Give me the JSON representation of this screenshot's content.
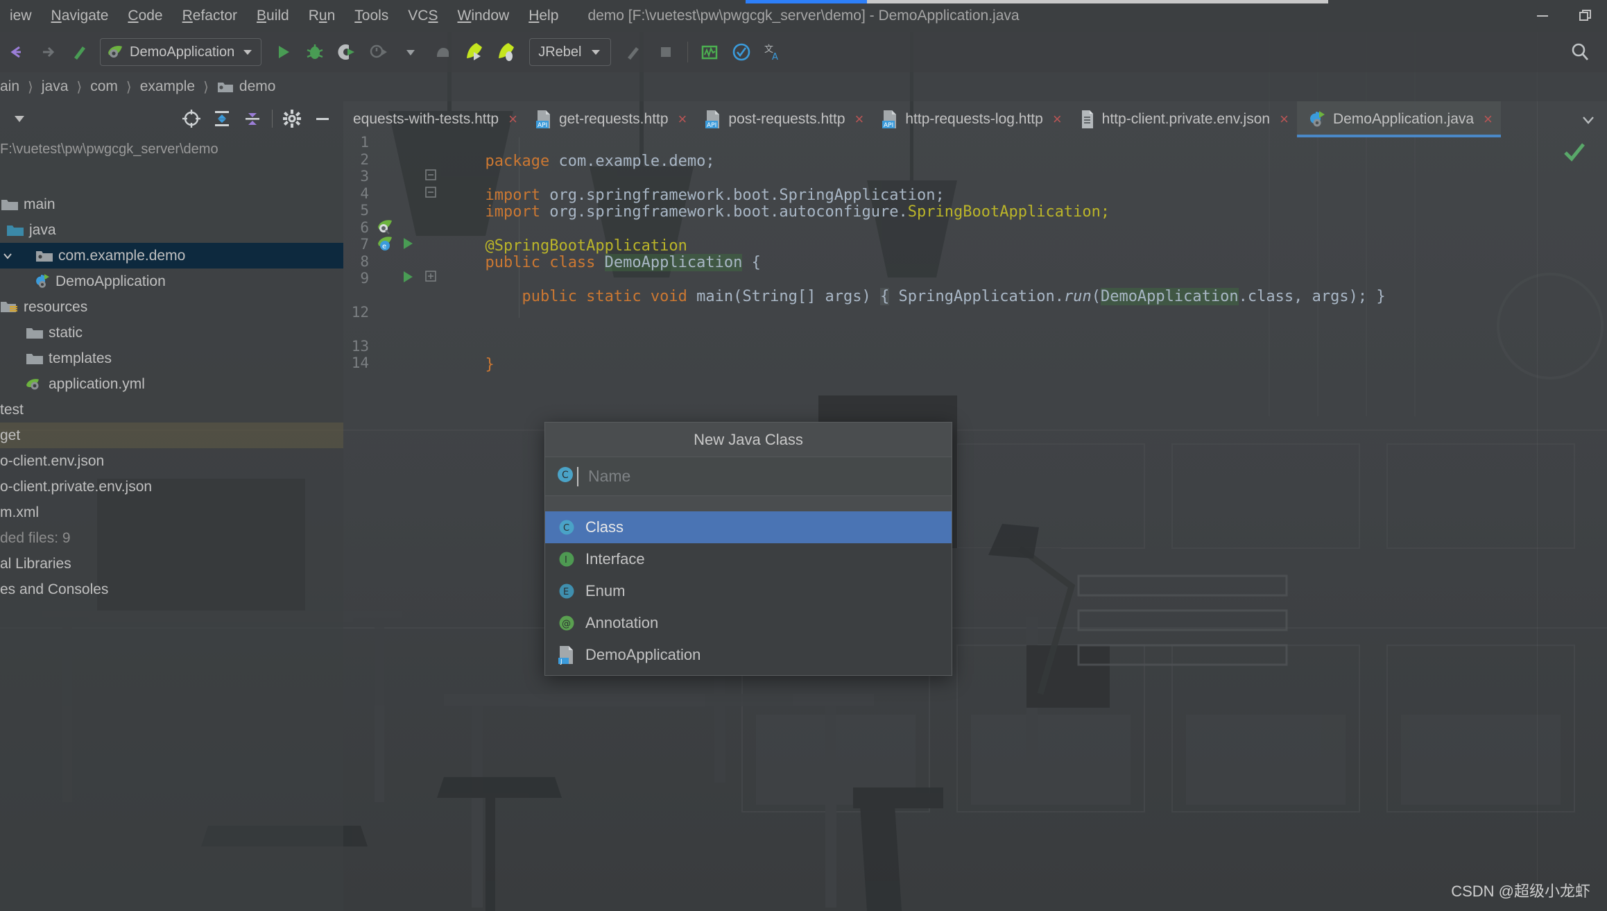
{
  "window": {
    "title": "demo [F:\\vuetest\\pw\\pwgcgk_server\\demo] - DemoApplication.java",
    "minimize_label": "minimize-window",
    "restore_label": "restore-window"
  },
  "menubar": {
    "items": [
      {
        "label": "iew",
        "mnemonic": ""
      },
      {
        "label": "Navigate",
        "mnemonic": "N"
      },
      {
        "label": "Code",
        "mnemonic": "C"
      },
      {
        "label": "Refactor",
        "mnemonic": "R"
      },
      {
        "label": "Build",
        "mnemonic": "B"
      },
      {
        "label": "Run",
        "mnemonic": "u"
      },
      {
        "label": "Tools",
        "mnemonic": "T"
      },
      {
        "label": "VCS",
        "mnemonic": "S"
      },
      {
        "label": "Window",
        "mnemonic": "W"
      },
      {
        "label": "Help",
        "mnemonic": "H"
      }
    ]
  },
  "toolbar": {
    "run_configuration": "DemoApplication",
    "jrebel_label": "JRebel",
    "icons": [
      "back-arrow-icon",
      "forward-arrow-icon",
      "build-hammer-icon",
      "run-icon",
      "debug-icon",
      "run-with-coverage-icon",
      "profiler-icon",
      "dropdown-icon",
      "attach-icon",
      "jrebel-run-icon",
      "jrebel-debug-icon",
      "build-project-icon",
      "stop-icon",
      "monitor-icon",
      "checked-circle-icon",
      "translate-icon",
      "search-everywhere-icon"
    ]
  },
  "breadcrumb": {
    "items": [
      "ain",
      "java",
      "com",
      "example",
      "demo"
    ]
  },
  "project_panel": {
    "toolbar_icons": [
      "select-opened-file-icon",
      "expand-collapse-icon",
      "collapse-all-icon",
      "settings-gear-icon",
      "hide-panel-icon"
    ],
    "root_path": "F:\\vuetest\\pw\\pwgcgk_server\\demo",
    "tree": [
      {
        "label": "main",
        "icon": "folder-icon",
        "indent": 0,
        "state": "none"
      },
      {
        "label": "java",
        "icon": "source-folder-icon",
        "indent": 1,
        "state": "none"
      },
      {
        "label": "com.example.demo",
        "icon": "package-icon",
        "indent": 2,
        "state": "selected",
        "chevron": "expanded"
      },
      {
        "label": "DemoApplication",
        "icon": "spring-class-icon",
        "indent": 3,
        "state": "none"
      },
      {
        "label": "resources",
        "icon": "resources-folder-icon",
        "indent": 1,
        "state": "none"
      },
      {
        "label": "static",
        "icon": "folder-icon",
        "indent": 2,
        "state": "none"
      },
      {
        "label": "templates",
        "icon": "folder-icon",
        "indent": 2,
        "state": "none"
      },
      {
        "label": "application.yml",
        "icon": "spring-yaml-icon",
        "indent": 2,
        "state": "none"
      },
      {
        "label": "test",
        "icon": "folder-icon",
        "indent": 0,
        "state": "none"
      },
      {
        "label": "get",
        "icon": "folder-icon",
        "indent": 0,
        "state": "highlight"
      },
      {
        "label": "o-client.env.json",
        "icon": "json-icon",
        "indent": 0,
        "state": "none"
      },
      {
        "label": "o-client.private.env.json",
        "icon": "json-icon",
        "indent": 0,
        "state": "none"
      },
      {
        "label": "m.xml",
        "icon": "maven-icon",
        "indent": 0,
        "state": "none"
      },
      {
        "label": "ded files: 9",
        "icon": "none",
        "indent": 0,
        "state": "dim"
      },
      {
        "label": "al Libraries",
        "icon": "library-icon",
        "indent": 0,
        "state": "none"
      },
      {
        "label": "es and Consoles",
        "icon": "scratches-icon",
        "indent": 0,
        "state": "none"
      }
    ]
  },
  "tabs": {
    "items": [
      {
        "label": "equests-with-tests.http",
        "icon": "http-file-icon",
        "active": false
      },
      {
        "label": "get-requests.http",
        "icon": "http-file-icon",
        "active": false
      },
      {
        "label": "post-requests.http",
        "icon": "http-file-icon",
        "active": false
      },
      {
        "label": "http-requests-log.http",
        "icon": "http-file-icon",
        "active": false
      },
      {
        "label": "http-client.private.env.json",
        "icon": "json-file-icon",
        "active": false
      },
      {
        "label": "DemoApplication.java",
        "icon": "spring-class-icon",
        "active": true
      }
    ],
    "close_glyph": "×",
    "overflow_icon": "chevron-down-icon"
  },
  "editor": {
    "line_numbers": [
      "1",
      "2",
      "3",
      "4",
      "5",
      "6",
      "7",
      "8",
      "9",
      "12",
      "13",
      "14"
    ],
    "inspection_status": "ok-check-icon",
    "lines": [
      {
        "n": 1,
        "tokens": [
          {
            "t": "package ",
            "c": "k"
          },
          {
            "t": "com.example.demo;",
            "c": "t"
          }
        ]
      },
      {
        "n": 2,
        "tokens": []
      },
      {
        "n": 3,
        "tokens": [
          {
            "t": "import ",
            "c": "k"
          },
          {
            "t": "org.springframework.boot.SpringApplication;",
            "c": "t"
          }
        ]
      },
      {
        "n": 4,
        "tokens": [
          {
            "t": "import ",
            "c": "k"
          },
          {
            "t": "org.springframework.boot.autoconfigure.",
            "c": "t"
          },
          {
            "t": "SpringBootApplication;",
            "c": "an"
          }
        ]
      },
      {
        "n": 5,
        "tokens": []
      },
      {
        "n": 6,
        "tokens": [
          {
            "t": "@SpringBootApplication",
            "c": "an"
          }
        ]
      },
      {
        "n": 7,
        "tokens": [
          {
            "t": "public class ",
            "c": "k"
          },
          {
            "t": "DemoApplication",
            "c": "hl-green"
          },
          {
            "t": " {",
            "c": "t"
          }
        ]
      },
      {
        "n": 8,
        "tokens": []
      },
      {
        "n": 9,
        "tokens": [
          {
            "t": "    public static void ",
            "c": "k"
          },
          {
            "t": "main",
            "c": "t"
          },
          {
            "t": "(String[] args) ",
            "c": "t"
          },
          {
            "t": "{",
            "c": "hl-grey"
          },
          {
            "t": " SpringApplication.",
            "c": "t"
          },
          {
            "t": "run",
            "c": "it"
          },
          {
            "t": "(",
            "c": "t"
          },
          {
            "t": "DemoApplication",
            "c": "hl-green"
          },
          {
            "t": ".class, args); }",
            "c": "t"
          }
        ]
      },
      {
        "n": 13,
        "tokens": [
          {
            "t": "}",
            "c": "k"
          }
        ]
      }
    ],
    "code_text": {
      "l1": "package com.example.demo;",
      "l3": "import org.springframework.boot.SpringApplication;",
      "l4": "import org.springframework.boot.autoconfigure.SpringBootApplication;",
      "l6": "@SpringBootApplication",
      "l7": "public class DemoApplication {",
      "l9": "    public static void main(String[] args) { SpringApplication.run(DemoApplication.class, args); }",
      "l13": "}"
    }
  },
  "popup": {
    "title": "New Java Class",
    "name_placeholder": "Name",
    "name_value": "",
    "name_icon": "class-icon",
    "items": [
      {
        "label": "Class",
        "icon": "class-icon",
        "selected": true
      },
      {
        "label": "Interface",
        "icon": "interface-icon",
        "selected": false
      },
      {
        "label": "Enum",
        "icon": "enum-icon",
        "selected": false
      },
      {
        "label": "Annotation",
        "icon": "annotation-icon",
        "selected": false
      },
      {
        "label": "DemoApplication",
        "icon": "java-file-icon",
        "selected": false
      }
    ]
  },
  "watermark": "CSDN @超级小龙虾",
  "colors": {
    "accent_blue": "#4a74b4",
    "selection_tree": "#0d293e",
    "keyword_orange": "#cc7832",
    "annotation_yellow": "#bbb529",
    "text_grey": "#a9b7c6",
    "run_green": "#499c54",
    "panel_bg": "#3c3f41"
  }
}
